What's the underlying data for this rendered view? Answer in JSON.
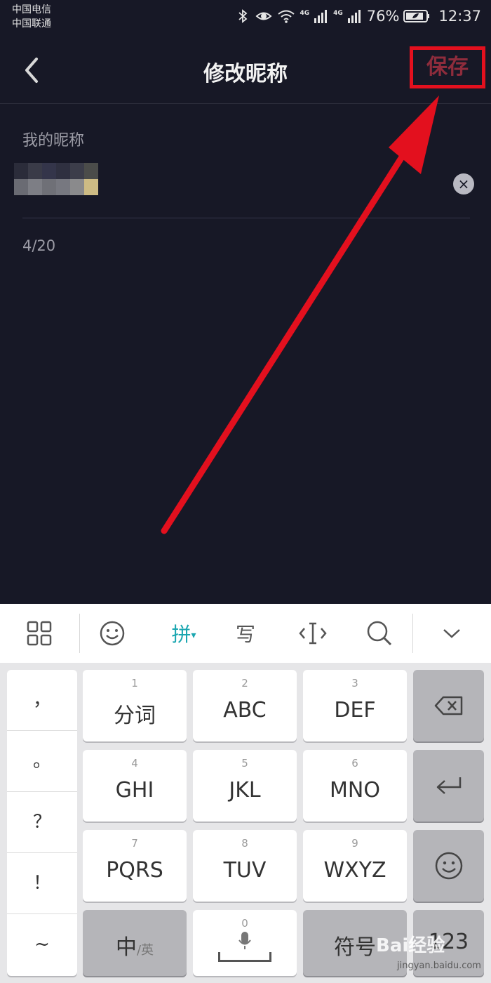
{
  "status_bar": {
    "carrier_1": "中国电信",
    "carrier_2": "中国联通",
    "network_1": "4G",
    "network_2": "4G",
    "battery": "76%",
    "time": "12:37"
  },
  "header": {
    "title": "修改昵称",
    "save_label": "保存"
  },
  "form": {
    "label": "我的昵称",
    "counter": "4/20",
    "clear_icon": "×"
  },
  "keyboard": {
    "toolbar": {
      "pinyin_label": "拼",
      "handwrite_label": "写"
    },
    "punctuation": [
      "，",
      "。",
      "？",
      "！",
      "~"
    ],
    "keys": [
      {
        "num": "1",
        "label": "分词"
      },
      {
        "num": "2",
        "label": "ABC"
      },
      {
        "num": "3",
        "label": "DEF"
      },
      {
        "num": "4",
        "label": "GHI"
      },
      {
        "num": "5",
        "label": "JKL"
      },
      {
        "num": "6",
        "label": "MNO"
      },
      {
        "num": "7",
        "label": "PQRS"
      },
      {
        "num": "8",
        "label": "TUV"
      },
      {
        "num": "9",
        "label": "WXYZ"
      }
    ],
    "lang_main": "中",
    "lang_sub": "/英",
    "space_num": "0",
    "symbol_label": "符号",
    "num_label": "123"
  },
  "watermark": {
    "brand": "Bai经验",
    "url": "jingyan.baidu.com"
  },
  "colors": {
    "background": "#171826",
    "highlight": "#e3101e",
    "accent": "#1aa6b0"
  }
}
